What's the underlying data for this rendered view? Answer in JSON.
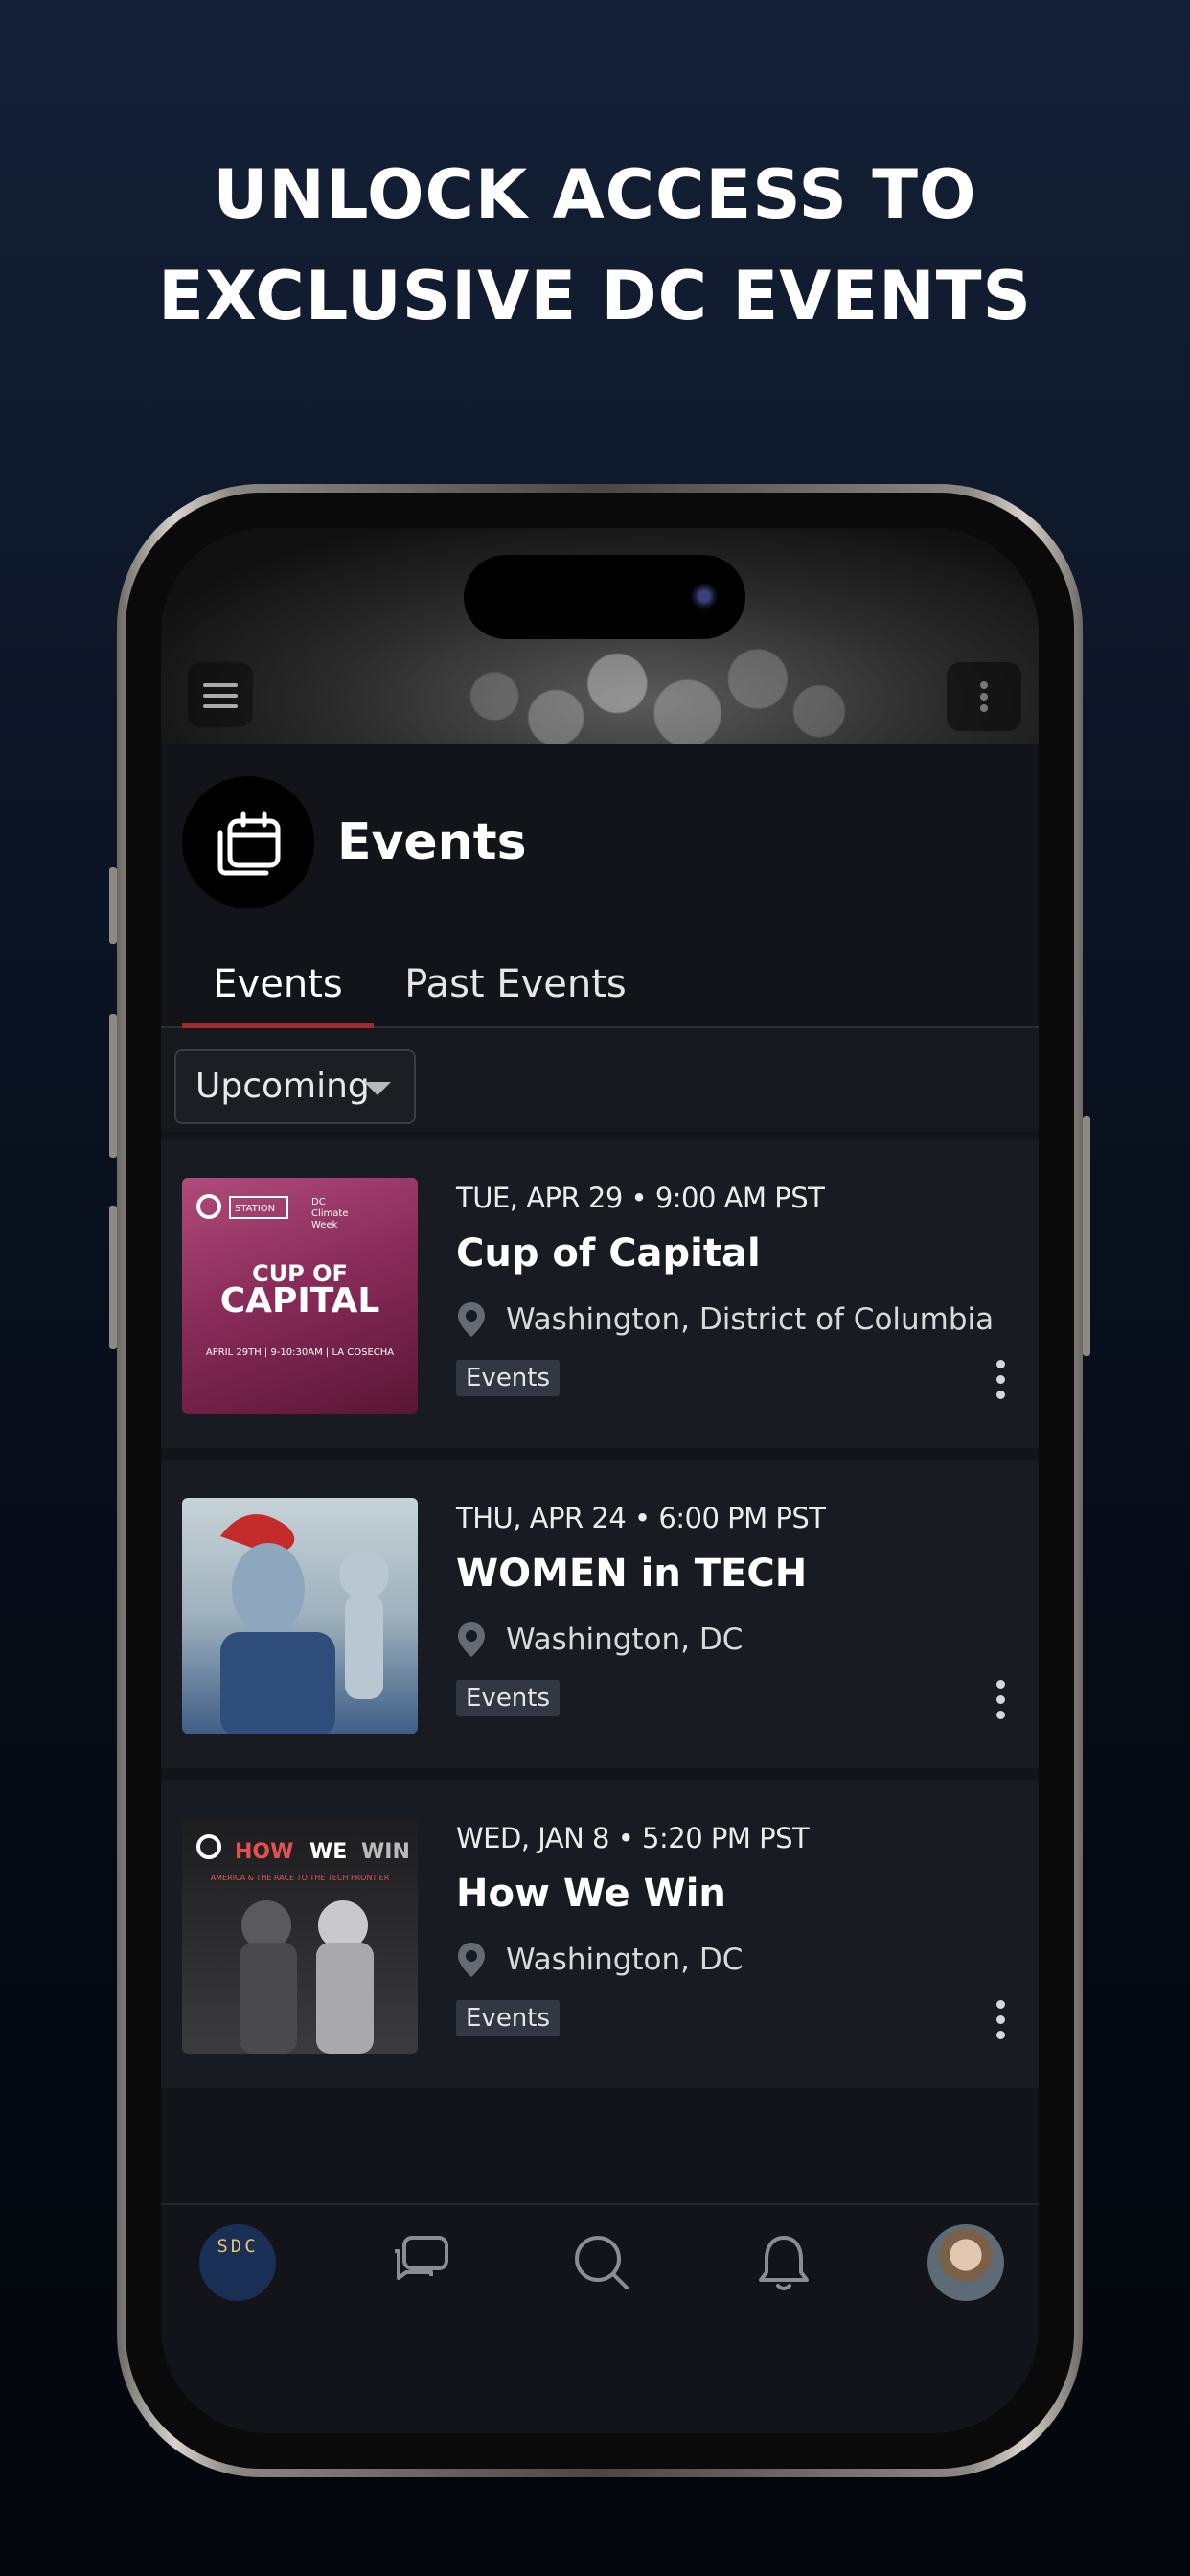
{
  "headline": {
    "line1": "UNLOCK ACCESS TO",
    "line2": "EXCLUSIVE DC EVENTS"
  },
  "app": {
    "page_title": "Events",
    "tabs": [
      {
        "label": "Events",
        "active": true
      },
      {
        "label": "Past Events",
        "active": false
      }
    ],
    "filter": {
      "selected": "Upcoming"
    },
    "events": [
      {
        "date": "TUE, APR 29 • 9:00 AM PST",
        "name": "Cup of Capital",
        "location": "Washington, District of Columbia",
        "tag": "Events",
        "thumb_text": "CUP OF CAPITAL",
        "thumb_sub": "APRIL 29TH | 9-10:30AM | LA COSECHA"
      },
      {
        "date": "THU, APR 24 • 6:00 PM PST",
        "name": "WOMEN in TECH",
        "location": "Washington, DC",
        "tag": "Events"
      },
      {
        "date": "WED, JAN 8 • 5:20 PM PST",
        "name": "How We Win",
        "location": "Washington, DC",
        "tag": "Events",
        "thumb_text": "HOW WE WIN",
        "thumb_sub": "AMERICA & THE RACE TO THE TECH FRONTIER"
      }
    ],
    "bottom_nav": {
      "home_logo_text": "SDC",
      "items": [
        "home-icon",
        "chat-icon",
        "search-icon",
        "bell-icon",
        "profile-avatar"
      ]
    }
  },
  "colors": {
    "background": "#0b1424",
    "tab_indicator": "#a02a2e",
    "card": "#181b22"
  }
}
